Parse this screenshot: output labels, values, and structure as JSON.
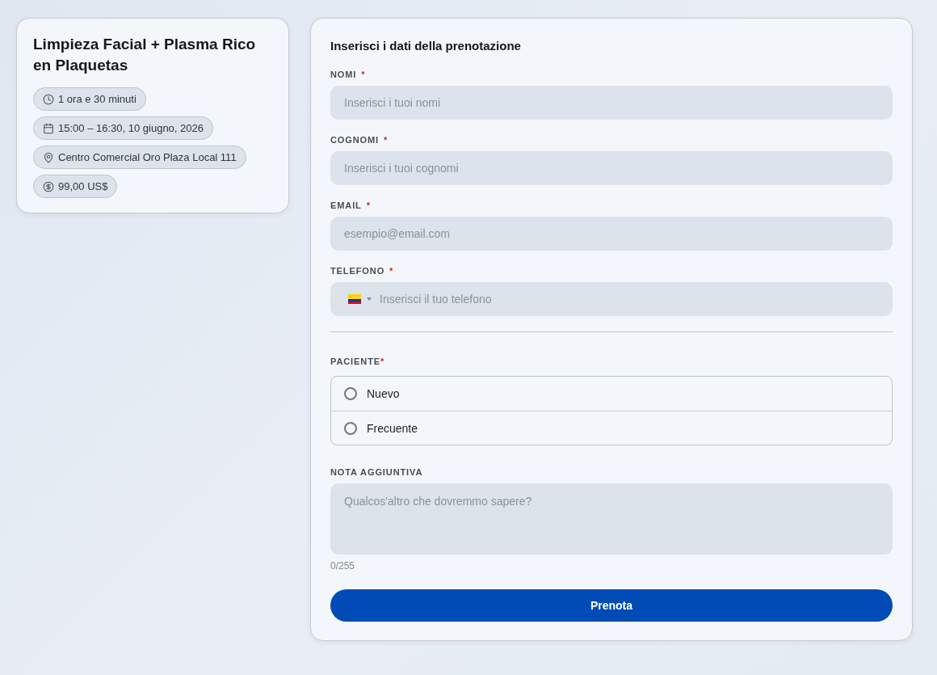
{
  "service": {
    "title": "Limpieza Facial + Plasma Rico en Plaquetas",
    "details": [
      {
        "kind": "duration",
        "text": "1 ora e 30 minuti"
      },
      {
        "kind": "date",
        "text": "15:00 – 16:30, 10 giugno, 2026"
      },
      {
        "kind": "location",
        "text": "Centro Comercial Oro Plaza Local 111"
      },
      {
        "kind": "price",
        "text": "99,00 US$"
      }
    ]
  },
  "form": {
    "heading": "Inserisci i dati della prenotazione",
    "fields": [
      {
        "kind": "text",
        "label": "NOMI",
        "required_mark": "*",
        "placeholder": "Inserisci i tuoi nomi"
      },
      {
        "kind": "text",
        "label": "COGNOMI",
        "required_mark": "*",
        "placeholder": "Inserisci i tuoi cognomi"
      },
      {
        "kind": "email",
        "label": "EMAIL",
        "required_mark": "*",
        "placeholder": "esempio@email.com"
      },
      {
        "kind": "phone",
        "label": "TELEFONO",
        "required_mark": "*",
        "placeholder": "Inserisci il tuo telefono"
      }
    ],
    "patient": {
      "label": "PACIENTE",
      "required_mark": "*",
      "options": [
        {
          "label": "Nuevo",
          "selected": false
        },
        {
          "label": "Frecuente",
          "selected": false
        }
      ]
    },
    "note": {
      "label": "NOTA AGGIUNTIVA",
      "placeholder": "Qualcos'altro che dovremmo sapere?",
      "counter": "0/255"
    },
    "submit": "Prenota"
  }
}
